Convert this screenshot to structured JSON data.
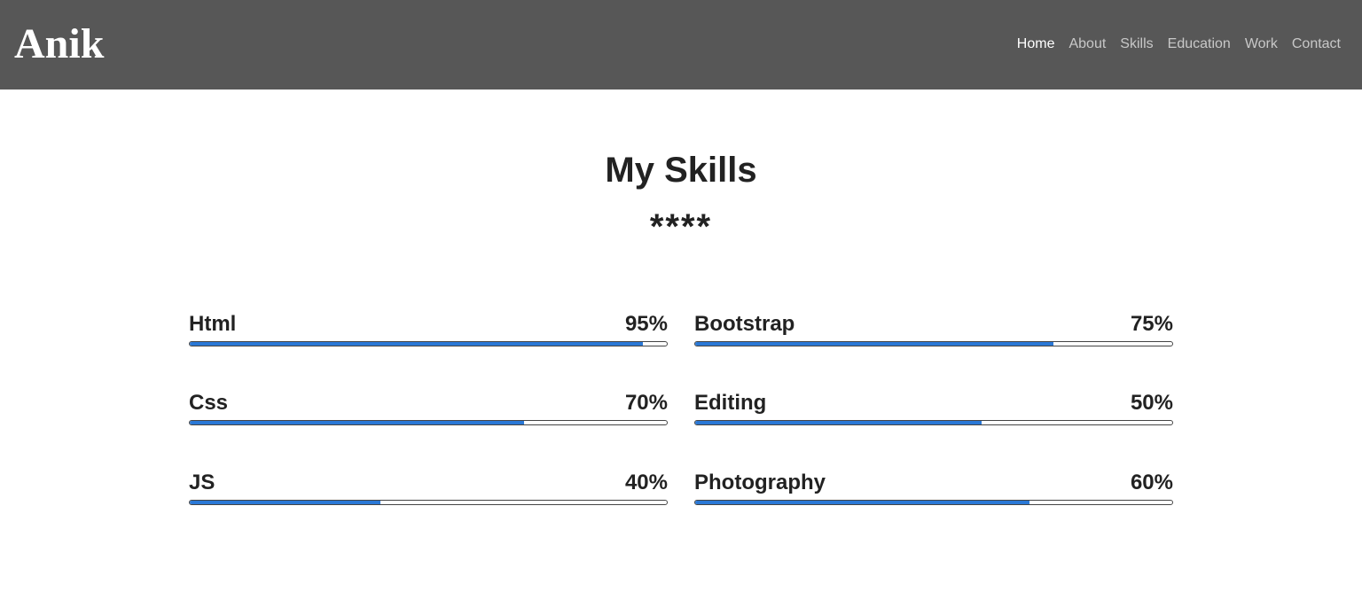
{
  "navbar": {
    "brand": "Anik",
    "items": [
      {
        "label": "Home",
        "active": true
      },
      {
        "label": "About",
        "active": false
      },
      {
        "label": "Skills",
        "active": false
      },
      {
        "label": "Education",
        "active": false
      },
      {
        "label": "Work",
        "active": false
      },
      {
        "label": "Contact",
        "active": false
      }
    ]
  },
  "section": {
    "title": "My Skills",
    "divider": "****"
  },
  "skills": [
    {
      "name": "Html",
      "percent_label": "95%",
      "fill_fraction": 0.95
    },
    {
      "name": "Bootstrap",
      "percent_label": "75%",
      "fill_fraction": 0.75
    },
    {
      "name": "Css",
      "percent_label": "70%",
      "fill_fraction": 0.7
    },
    {
      "name": "Editing",
      "percent_label": "50%",
      "fill_fraction": 0.6
    },
    {
      "name": "JS",
      "percent_label": "40%",
      "fill_fraction": 0.4
    },
    {
      "name": "Photography",
      "percent_label": "60%",
      "fill_fraction": 0.7
    }
  ],
  "colors": {
    "navbar_bg": "#575757",
    "bar_fill": "#2a78d6",
    "text": "#222222"
  }
}
